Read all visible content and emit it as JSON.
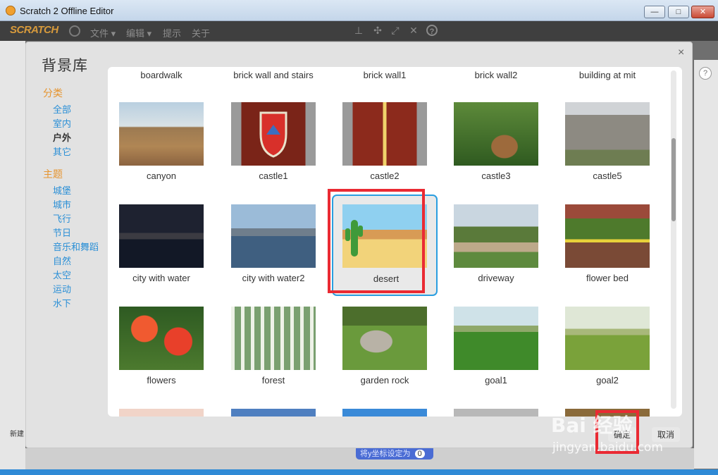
{
  "window": {
    "title": "Scratch 2 Offline Editor",
    "min": "—",
    "max": "□",
    "close": "✕"
  },
  "menubar": {
    "logo": "SCRATCH",
    "items": [
      "文件 ▾",
      "编辑 ▾",
      "提示",
      "关于"
    ],
    "tools": [
      "stamp-icon",
      "grow-icon",
      "expand-icon",
      "shrink-icon",
      "help-icon"
    ]
  },
  "dialog": {
    "title": "背景库",
    "close": "×",
    "category_header": "分类",
    "categories": [
      "全部",
      "室内",
      "户外",
      "其它"
    ],
    "active_category": "户外",
    "theme_header": "主题",
    "themes": [
      "城堡",
      "城市",
      "飞行",
      "节日",
      "音乐和舞蹈",
      "自然",
      "太空",
      "运动",
      "水下"
    ],
    "top_row": [
      "boardwalk",
      "brick wall and stairs",
      "brick wall1",
      "brick wall2",
      "building at mit"
    ],
    "rows": [
      [
        "canyon",
        "castle1",
        "castle2",
        "castle3",
        "castle5"
      ],
      [
        "city with water",
        "city with water2",
        "desert",
        "driveway",
        "flower bed"
      ],
      [
        "flowers",
        "forest",
        "garden rock",
        "goal1",
        "goal2"
      ]
    ],
    "selected": "desert",
    "ok_label": "确定",
    "cancel_label": "取消"
  },
  "background": {
    "new_label": "新建",
    "chip_label": "将y坐标设定为",
    "chip_value": "0",
    "help": "?"
  },
  "watermark": {
    "brand": "Bai 经验",
    "url": "jingyan.baidu.com"
  },
  "colors": {
    "accent": "#2a9ee0",
    "highlight": "#ea2a33",
    "category": "#e6942e",
    "link": "#2a8fd6"
  }
}
